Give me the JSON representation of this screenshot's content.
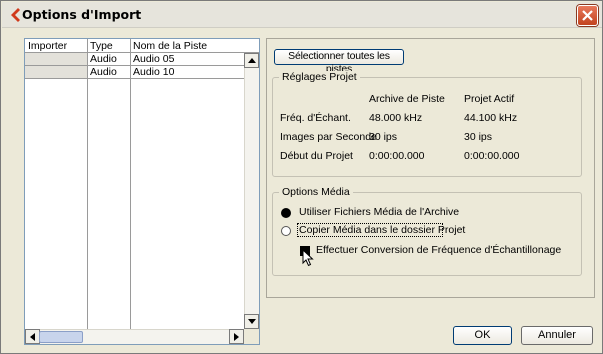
{
  "window": {
    "title": "Options d'Import",
    "close_label": "close"
  },
  "table": {
    "columns": [
      "Importer",
      "Type",
      "Nom de la Piste"
    ],
    "rows": [
      {
        "importer": "",
        "type": "Audio",
        "name": "Audio 05"
      },
      {
        "importer": "",
        "type": "Audio",
        "name": "Audio 10"
      }
    ]
  },
  "select_all_label": "Sélectionner toutes les pistes",
  "project_settings": {
    "legend": "Réglages Projet",
    "col_archive": "Archive de Piste",
    "col_active": "Projet Actif",
    "rows": [
      {
        "label": "Fréq. d'Échant.",
        "archive": "48.000 kHz",
        "active": "44.100 kHz"
      },
      {
        "label": "Images par Seconde",
        "archive": "30 ips",
        "active": "30 ips"
      },
      {
        "label": "Début du Projet",
        "archive": "0:00:00.000",
        "active": "0:00:00.000"
      }
    ]
  },
  "media_options": {
    "legend": "Options Média",
    "use_archive_label": "Utiliser Fichiers Média de l'Archive",
    "copy_media_label": "Copier Média dans le dossier Projet",
    "convert_label": "Effectuer Conversion de Fréquence d'Échantillonage",
    "selected": "use_archive",
    "convert_checked": true
  },
  "buttons": {
    "ok": "OK",
    "cancel": "Annuler"
  },
  "colors": {
    "accent_red": "#d0391b",
    "close_red": "#d45a36",
    "selection_border": "#003c74"
  }
}
